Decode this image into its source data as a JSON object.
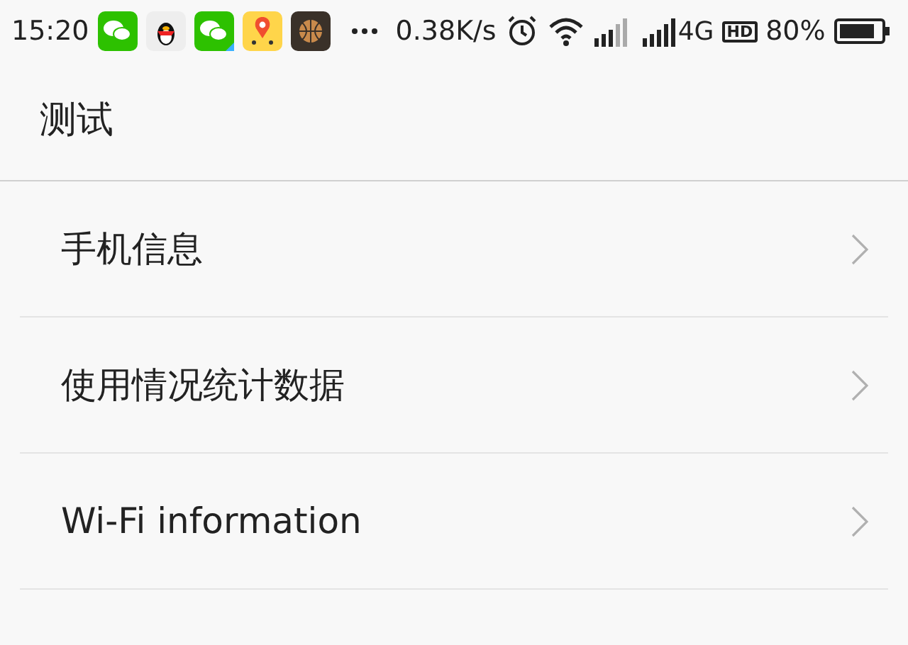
{
  "status_bar": {
    "time": "15:20",
    "speed": "0.38K/s",
    "network": "4G",
    "hd": "HD",
    "battery": "80%"
  },
  "title": "测试",
  "items": [
    {
      "label": "手机信息"
    },
    {
      "label": "使用情况统计数据"
    },
    {
      "label": "Wi-Fi information"
    }
  ]
}
